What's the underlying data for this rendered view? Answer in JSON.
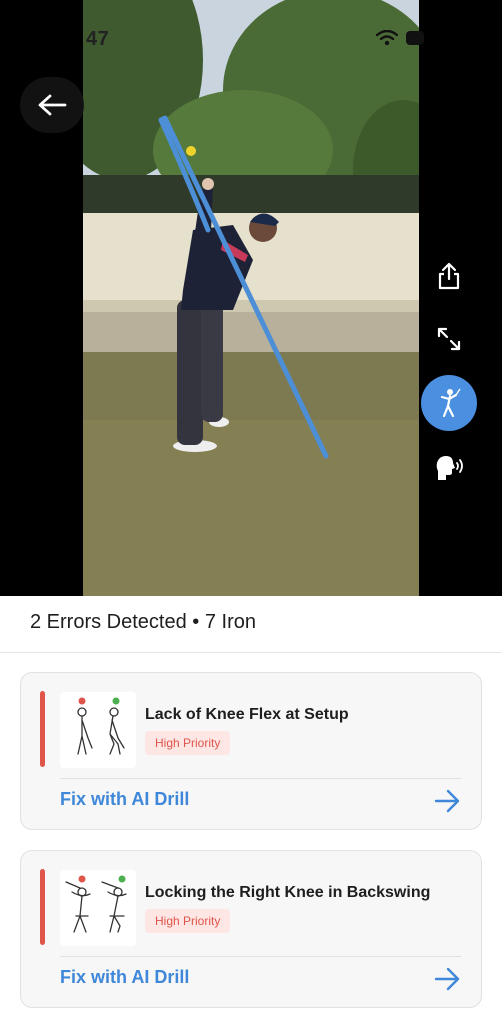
{
  "status_bar": {
    "time": "47"
  },
  "summary": {
    "text": "2 Errors Detected • 7 Iron"
  },
  "issues": [
    {
      "title": "Lack of Knee Flex at Setup",
      "priority": "High Priority",
      "action": "Fix with AI Drill"
    },
    {
      "title": "Locking the Right Knee in Backswing",
      "priority": "High Priority",
      "action": "Fix with AI Drill"
    }
  ],
  "colors": {
    "accent_blue": "#3f87d8",
    "active_button_blue": "#4a8fe0",
    "error_red": "#e0554a",
    "badge_bg": "#fde6e4",
    "swing_path": "#4d8fd6",
    "ball_marker": "#f0d32a"
  },
  "icons": {
    "back": "back-arrow-icon",
    "share": "share-icon",
    "fullscreen": "expand-icon",
    "swing_view": "golfer-icon",
    "voice": "voice-icon",
    "fix_arrow": "arrow-right-icon"
  }
}
